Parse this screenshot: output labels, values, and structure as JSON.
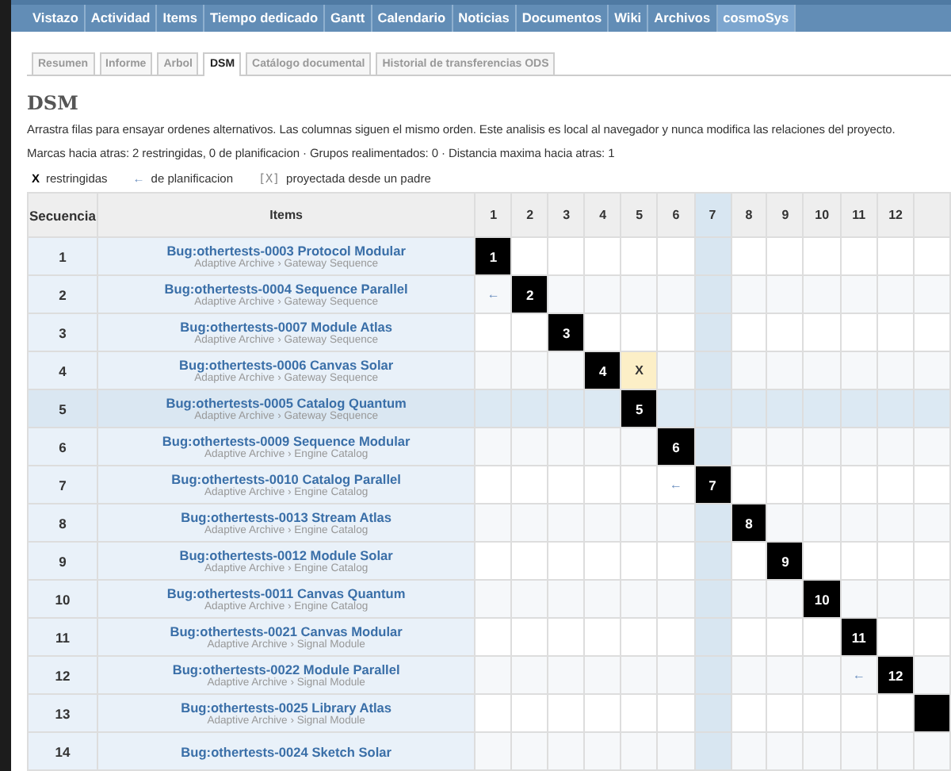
{
  "top_menu": [
    {
      "label": "Vistazo",
      "selected": false
    },
    {
      "label": "Actividad",
      "selected": false
    },
    {
      "label": "Items",
      "selected": false
    },
    {
      "label": "Tiempo dedicado",
      "selected": false
    },
    {
      "label": "Gantt",
      "selected": false
    },
    {
      "label": "Calendario",
      "selected": false
    },
    {
      "label": "Noticias",
      "selected": false
    },
    {
      "label": "Documentos",
      "selected": false
    },
    {
      "label": "Wiki",
      "selected": false
    },
    {
      "label": "Archivos",
      "selected": false
    },
    {
      "label": "cosmoSys",
      "selected": true
    }
  ],
  "tabs": [
    {
      "label": "Resumen",
      "selected": false
    },
    {
      "label": "Informe",
      "selected": false
    },
    {
      "label": "Arbol",
      "selected": false
    },
    {
      "label": "DSM",
      "selected": true
    },
    {
      "label": "Catálogo documental",
      "selected": false
    },
    {
      "label": "Historial de transferencias ODS",
      "selected": false
    }
  ],
  "title": "DSM",
  "description": "Arrastra filas para ensayar ordenes alternativos. Las columnas siguen el mismo orden. Este analisis es local al navegador y nunca modifica las relaciones del proyecto.",
  "stats": "Marcas hacia atras: 2 restringidas, 0 de planificacion · Grupos realimentados: 0 · Distancia maxima hacia atras: 1",
  "legend": [
    {
      "kind": "restricted",
      "symbol": "X",
      "label": "restringidas"
    },
    {
      "kind": "planning",
      "symbol": "←",
      "label": "de planificacion"
    },
    {
      "kind": "projected",
      "symbol": "[X]",
      "label": "proyectada desde un padre"
    }
  ],
  "table": {
    "sequence_header": "Secuencia",
    "items_header": "Items",
    "columns": [
      {
        "label": "1",
        "highlighted": false
      },
      {
        "label": "2",
        "highlighted": false
      },
      {
        "label": "3",
        "highlighted": false
      },
      {
        "label": "4",
        "highlighted": false
      },
      {
        "label": "5",
        "highlighted": false
      },
      {
        "label": "6",
        "highlighted": false
      },
      {
        "label": "7",
        "highlighted": true
      },
      {
        "label": "8",
        "highlighted": false
      },
      {
        "label": "9",
        "highlighted": false
      },
      {
        "label": "10",
        "highlighted": false
      },
      {
        "label": "11",
        "highlighted": false
      },
      {
        "label": "12",
        "highlighted": false
      },
      {
        "highlighted": false
      }
    ],
    "rows": [
      {
        "sequence": "1",
        "title": "Bug:othertests-0003 Protocol Modular",
        "path": "Adaptive Archive › Gateway Sequence",
        "highlighted": false,
        "cells": [
          {
            "kind": "diagonal",
            "text": "1"
          },
          {
            "kind": "empty"
          },
          {
            "kind": "empty"
          },
          {
            "kind": "empty"
          },
          {
            "kind": "empty"
          },
          {
            "kind": "empty"
          },
          {
            "kind": "empty"
          },
          {
            "kind": "empty"
          },
          {
            "kind": "empty"
          },
          {
            "kind": "empty"
          },
          {
            "kind": "empty"
          },
          {
            "kind": "empty"
          },
          {
            "kind": "empty"
          }
        ]
      },
      {
        "sequence": "2",
        "title": "Bug:othertests-0004 Sequence Parallel",
        "path": "Adaptive Archive › Gateway Sequence",
        "highlighted": false,
        "cells": [
          {
            "kind": "planning",
            "text": "←"
          },
          {
            "kind": "diagonal",
            "text": "2"
          },
          {
            "kind": "empty"
          },
          {
            "kind": "empty"
          },
          {
            "kind": "empty"
          },
          {
            "kind": "empty"
          },
          {
            "kind": "empty"
          },
          {
            "kind": "empty"
          },
          {
            "kind": "empty"
          },
          {
            "kind": "empty"
          },
          {
            "kind": "empty"
          },
          {
            "kind": "empty"
          },
          {
            "kind": "empty"
          }
        ]
      },
      {
        "sequence": "3",
        "title": "Bug:othertests-0007 Module Atlas",
        "path": "Adaptive Archive › Gateway Sequence",
        "highlighted": false,
        "cells": [
          {
            "kind": "empty"
          },
          {
            "kind": "empty"
          },
          {
            "kind": "diagonal",
            "text": "3"
          },
          {
            "kind": "empty"
          },
          {
            "kind": "empty"
          },
          {
            "kind": "empty"
          },
          {
            "kind": "empty"
          },
          {
            "kind": "empty"
          },
          {
            "kind": "empty"
          },
          {
            "kind": "empty"
          },
          {
            "kind": "empty"
          },
          {
            "kind": "empty"
          },
          {
            "kind": "empty"
          }
        ]
      },
      {
        "sequence": "4",
        "title": "Bug:othertests-0006 Canvas Solar",
        "path": "Adaptive Archive › Gateway Sequence",
        "highlighted": false,
        "cells": [
          {
            "kind": "empty"
          },
          {
            "kind": "empty"
          },
          {
            "kind": "empty"
          },
          {
            "kind": "diagonal",
            "text": "4"
          },
          {
            "kind": "restricted",
            "text": "X"
          },
          {
            "kind": "empty"
          },
          {
            "kind": "empty"
          },
          {
            "kind": "empty"
          },
          {
            "kind": "empty"
          },
          {
            "kind": "empty"
          },
          {
            "kind": "empty"
          },
          {
            "kind": "empty"
          },
          {
            "kind": "empty"
          }
        ]
      },
      {
        "sequence": "5",
        "title": "Bug:othertests-0005 Catalog Quantum",
        "path": "Adaptive Archive › Gateway Sequence",
        "highlighted": true,
        "cells": [
          {
            "kind": "empty"
          },
          {
            "kind": "empty"
          },
          {
            "kind": "empty"
          },
          {
            "kind": "empty"
          },
          {
            "kind": "diagonal",
            "text": "5"
          },
          {
            "kind": "empty"
          },
          {
            "kind": "empty"
          },
          {
            "kind": "empty"
          },
          {
            "kind": "empty"
          },
          {
            "kind": "empty"
          },
          {
            "kind": "empty"
          },
          {
            "kind": "empty"
          },
          {
            "kind": "empty"
          }
        ]
      },
      {
        "sequence": "6",
        "title": "Bug:othertests-0009 Sequence Modular",
        "path": "Adaptive Archive › Engine Catalog",
        "highlighted": false,
        "cells": [
          {
            "kind": "empty"
          },
          {
            "kind": "empty"
          },
          {
            "kind": "empty"
          },
          {
            "kind": "empty"
          },
          {
            "kind": "empty"
          },
          {
            "kind": "diagonal",
            "text": "6"
          },
          {
            "kind": "empty"
          },
          {
            "kind": "empty"
          },
          {
            "kind": "empty"
          },
          {
            "kind": "empty"
          },
          {
            "kind": "empty"
          },
          {
            "kind": "empty"
          },
          {
            "kind": "empty"
          }
        ]
      },
      {
        "sequence": "7",
        "title": "Bug:othertests-0010 Catalog Parallel",
        "path": "Adaptive Archive › Engine Catalog",
        "highlighted": false,
        "cells": [
          {
            "kind": "empty"
          },
          {
            "kind": "empty"
          },
          {
            "kind": "empty"
          },
          {
            "kind": "empty"
          },
          {
            "kind": "empty"
          },
          {
            "kind": "planning",
            "text": "←"
          },
          {
            "kind": "diagonal",
            "text": "7"
          },
          {
            "kind": "empty"
          },
          {
            "kind": "empty"
          },
          {
            "kind": "empty"
          },
          {
            "kind": "empty"
          },
          {
            "kind": "empty"
          },
          {
            "kind": "empty"
          }
        ]
      },
      {
        "sequence": "8",
        "title": "Bug:othertests-0013 Stream Atlas",
        "path": "Adaptive Archive › Engine Catalog",
        "highlighted": false,
        "cells": [
          {
            "kind": "empty"
          },
          {
            "kind": "empty"
          },
          {
            "kind": "empty"
          },
          {
            "kind": "empty"
          },
          {
            "kind": "empty"
          },
          {
            "kind": "empty"
          },
          {
            "kind": "empty"
          },
          {
            "kind": "diagonal",
            "text": "8"
          },
          {
            "kind": "empty"
          },
          {
            "kind": "empty"
          },
          {
            "kind": "empty"
          },
          {
            "kind": "empty"
          },
          {
            "kind": "empty"
          }
        ]
      },
      {
        "sequence": "9",
        "title": "Bug:othertests-0012 Module Solar",
        "path": "Adaptive Archive › Engine Catalog",
        "highlighted": false,
        "cells": [
          {
            "kind": "empty"
          },
          {
            "kind": "empty"
          },
          {
            "kind": "empty"
          },
          {
            "kind": "empty"
          },
          {
            "kind": "empty"
          },
          {
            "kind": "empty"
          },
          {
            "kind": "empty"
          },
          {
            "kind": "empty"
          },
          {
            "kind": "diagonal",
            "text": "9"
          },
          {
            "kind": "empty"
          },
          {
            "kind": "empty"
          },
          {
            "kind": "empty"
          },
          {
            "kind": "empty"
          }
        ]
      },
      {
        "sequence": "10",
        "title": "Bug:othertests-0011 Canvas Quantum",
        "path": "Adaptive Archive › Engine Catalog",
        "highlighted": false,
        "cells": [
          {
            "kind": "empty"
          },
          {
            "kind": "empty"
          },
          {
            "kind": "empty"
          },
          {
            "kind": "empty"
          },
          {
            "kind": "empty"
          },
          {
            "kind": "empty"
          },
          {
            "kind": "empty"
          },
          {
            "kind": "empty"
          },
          {
            "kind": "empty"
          },
          {
            "kind": "diagonal",
            "text": "10"
          },
          {
            "kind": "empty"
          },
          {
            "kind": "empty"
          },
          {
            "kind": "empty"
          }
        ]
      },
      {
        "sequence": "11",
        "title": "Bug:othertests-0021 Canvas Modular",
        "path": "Adaptive Archive › Signal Module",
        "highlighted": false,
        "cells": [
          {
            "kind": "empty"
          },
          {
            "kind": "empty"
          },
          {
            "kind": "empty"
          },
          {
            "kind": "empty"
          },
          {
            "kind": "empty"
          },
          {
            "kind": "empty"
          },
          {
            "kind": "empty"
          },
          {
            "kind": "empty"
          },
          {
            "kind": "empty"
          },
          {
            "kind": "empty"
          },
          {
            "kind": "diagonal",
            "text": "11"
          },
          {
            "kind": "empty"
          },
          {
            "kind": "empty"
          }
        ]
      },
      {
        "sequence": "12",
        "title": "Bug:othertests-0022 Module Parallel",
        "path": "Adaptive Archive › Signal Module",
        "highlighted": false,
        "cells": [
          {
            "kind": "empty"
          },
          {
            "kind": "empty"
          },
          {
            "kind": "empty"
          },
          {
            "kind": "empty"
          },
          {
            "kind": "empty"
          },
          {
            "kind": "empty"
          },
          {
            "kind": "empty"
          },
          {
            "kind": "empty"
          },
          {
            "kind": "empty"
          },
          {
            "kind": "empty"
          },
          {
            "kind": "planning",
            "text": "←"
          },
          {
            "kind": "diagonal",
            "text": "12"
          },
          {
            "kind": "empty"
          }
        ]
      },
      {
        "sequence": "13",
        "title": "Bug:othertests-0025 Library Atlas",
        "path": "Adaptive Archive › Signal Module",
        "highlighted": false,
        "cells": [
          {
            "kind": "empty"
          },
          {
            "kind": "empty"
          },
          {
            "kind": "empty"
          },
          {
            "kind": "empty"
          },
          {
            "kind": "empty"
          },
          {
            "kind": "empty"
          },
          {
            "kind": "empty"
          },
          {
            "kind": "empty"
          },
          {
            "kind": "empty"
          },
          {
            "kind": "empty"
          },
          {
            "kind": "empty"
          },
          {
            "kind": "empty"
          },
          {
            "kind": "diagonal"
          }
        ]
      },
      {
        "sequence": "14",
        "title": "Bug:othertests-0024 Sketch Solar",
        "highlighted": false,
        "cells": [
          {
            "kind": "empty"
          },
          {
            "kind": "empty"
          },
          {
            "kind": "empty"
          },
          {
            "kind": "empty"
          },
          {
            "kind": "empty"
          },
          {
            "kind": "empty"
          },
          {
            "kind": "empty"
          },
          {
            "kind": "empty"
          },
          {
            "kind": "empty"
          },
          {
            "kind": "empty"
          },
          {
            "kind": "empty"
          },
          {
            "kind": "empty"
          },
          {
            "kind": "empty"
          }
        ]
      }
    ]
  }
}
